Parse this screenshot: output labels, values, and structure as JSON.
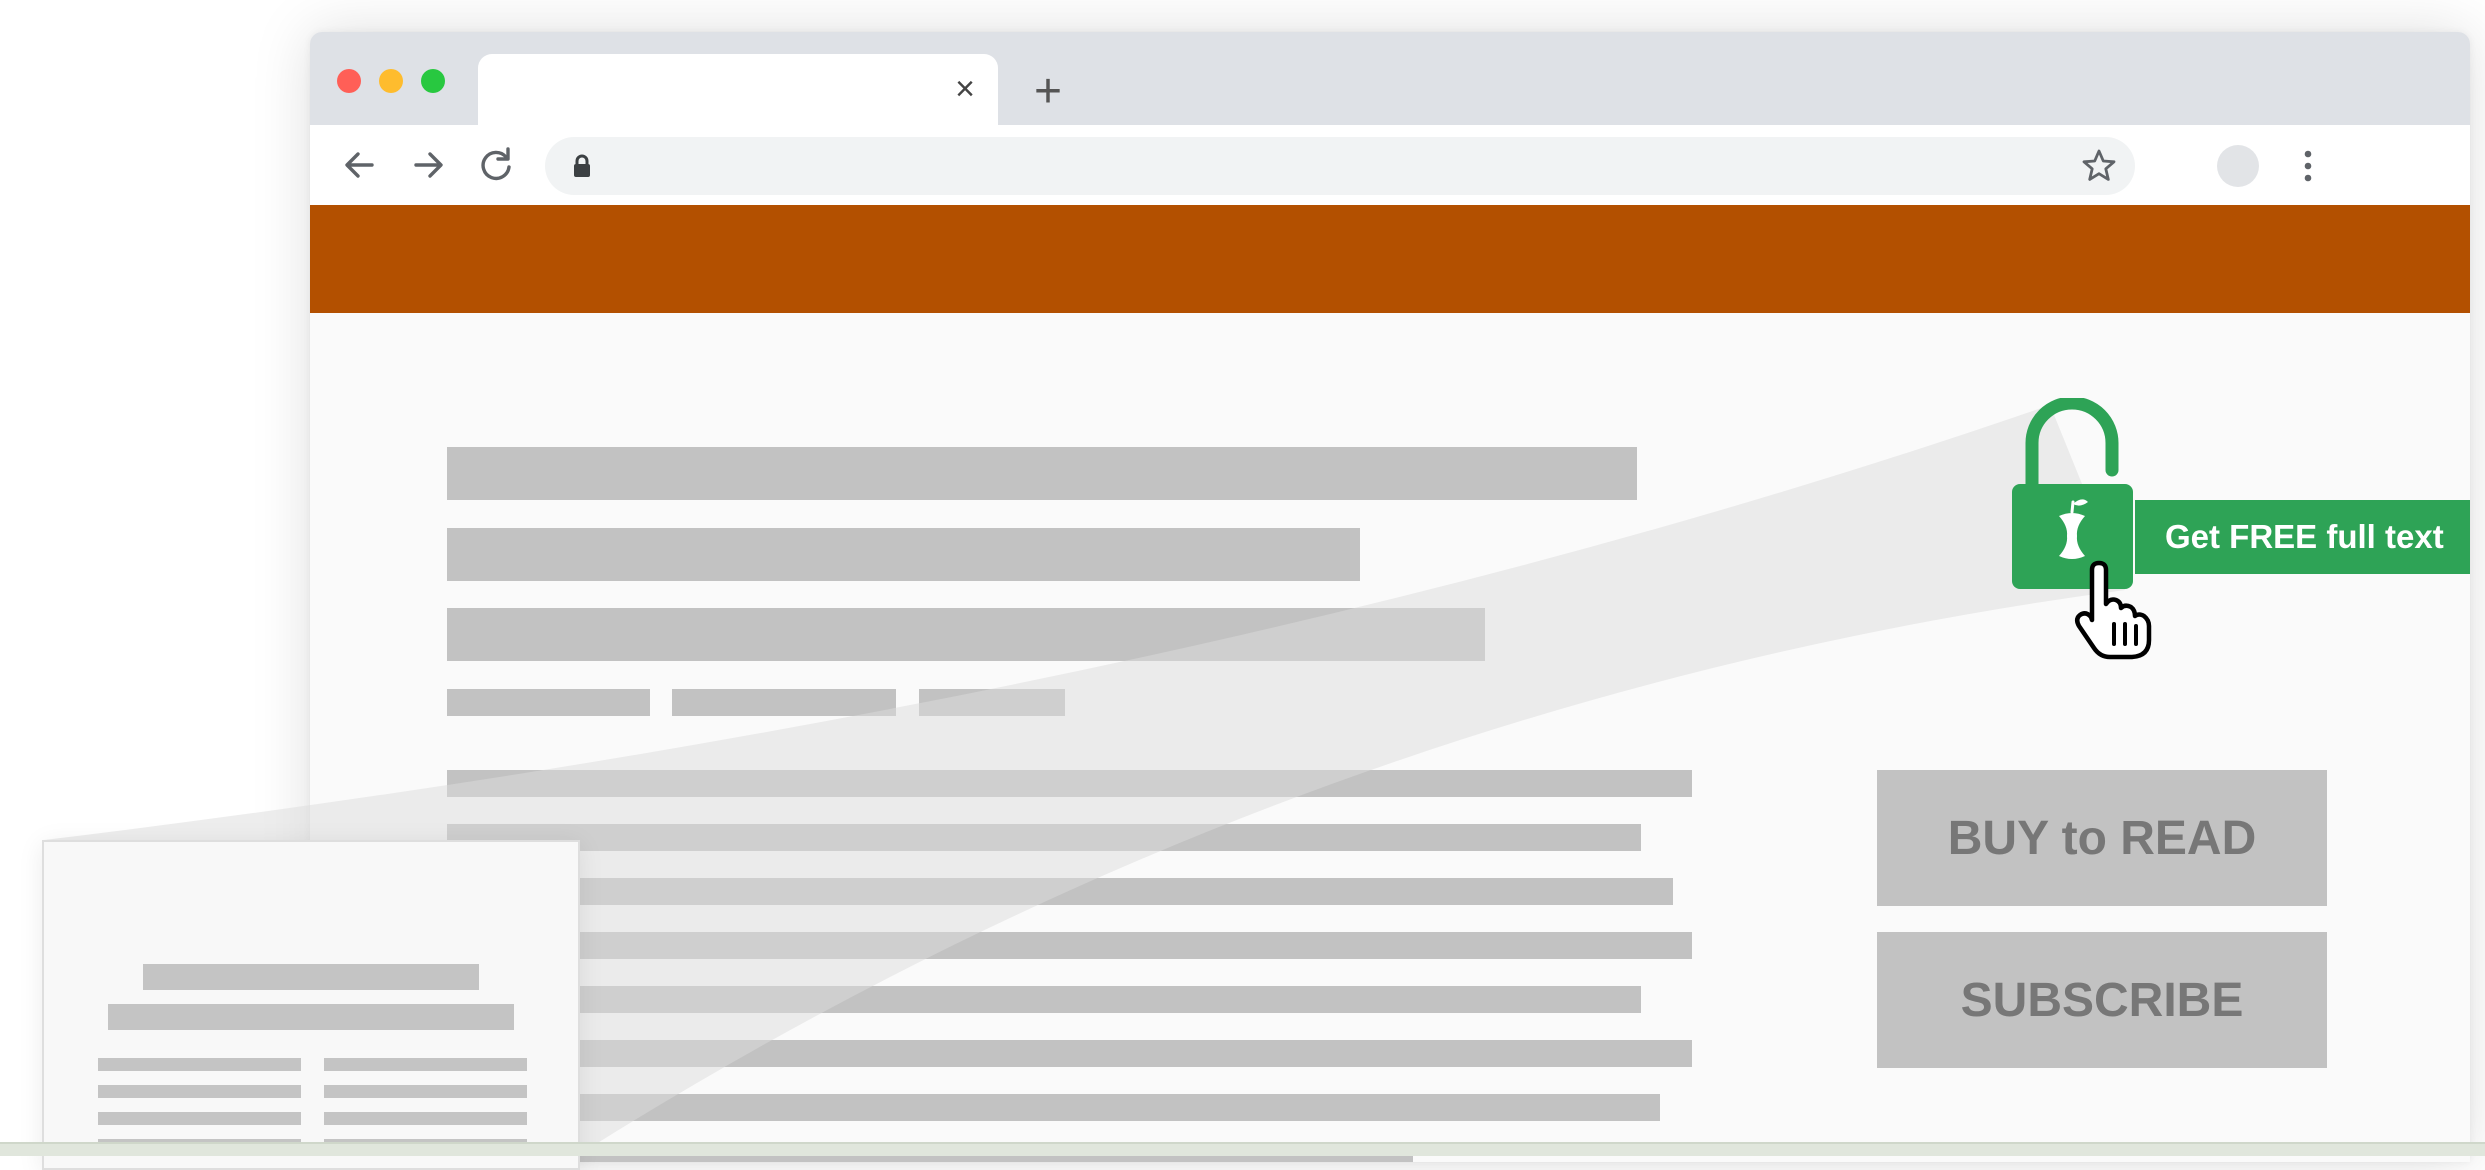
{
  "browser": {
    "tab_close_glyph": "×",
    "new_tab_glyph": "+",
    "back_icon": "arrow-left",
    "forward_icon": "arrow-right",
    "reload_icon": "reload",
    "lock_icon": "lock",
    "bookmark_icon": "star-outline",
    "menu_icon": "vertical-dots",
    "traffic_lights": [
      "#ff5f57",
      "#febc2e",
      "#28c840"
    ]
  },
  "page": {
    "banner_color": "#b35000",
    "buy_button_label": "BUY to READ",
    "subscribe_button_label": "SUBSCRIBE"
  },
  "unpaywall": {
    "label": "Get FREE full text",
    "accent_color": "#2ea356",
    "icon": "open-padlock-apple-core"
  }
}
